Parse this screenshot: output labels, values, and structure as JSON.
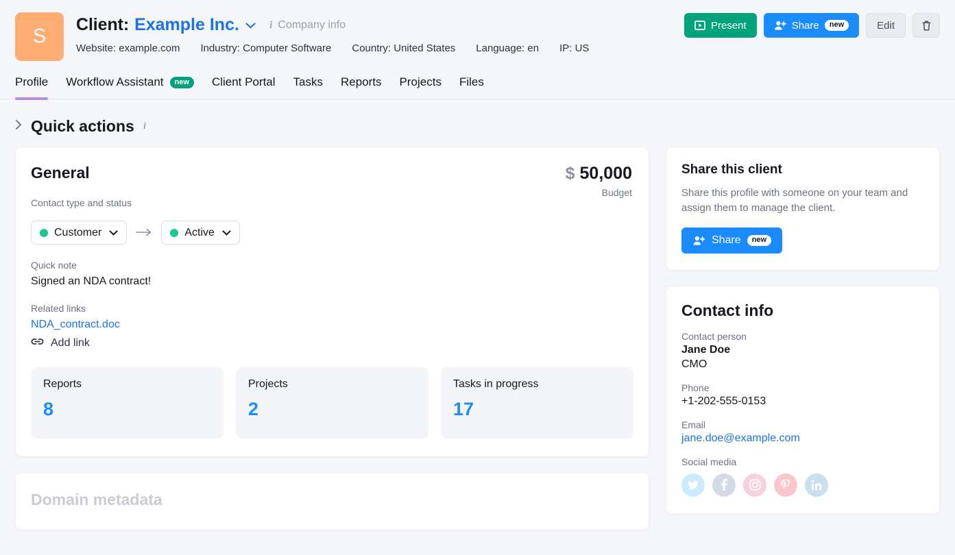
{
  "header": {
    "avatar_initial": "S",
    "avatar_color": "#ffad72",
    "title_prefix": "Client:",
    "client_name": "Example Inc.",
    "chevron": "⌄",
    "info_icon_glyph": "i",
    "company_info_label": "Company info",
    "meta": [
      "Website: example.com",
      "Industry: Computer Software",
      "Country: United States",
      "Language: en",
      "IP: US"
    ],
    "actions": {
      "present_label": "Present",
      "share_label": "Share",
      "share_badge": "new",
      "edit_label": "Edit",
      "present_color": "#00a37c",
      "share_color": "#1a8cff"
    }
  },
  "tabs": {
    "active_index": 0,
    "accent_color": "#b98be8",
    "items": [
      {
        "label": "Profile",
        "badge": ""
      },
      {
        "label": "Workflow Assistant",
        "badge": "new"
      },
      {
        "label": "Client Portal",
        "badge": ""
      },
      {
        "label": "Tasks",
        "badge": ""
      },
      {
        "label": "Reports",
        "badge": ""
      },
      {
        "label": "Projects",
        "badge": ""
      },
      {
        "label": "Files",
        "badge": ""
      }
    ]
  },
  "quick_actions": {
    "chevron": "›",
    "title": "Quick actions",
    "info_icon_glyph": "i"
  },
  "general": {
    "title": "General",
    "budget_currency": "$",
    "budget_amount": "50,000",
    "budget_label": "Budget",
    "contact_type_label": "Contact type and status",
    "contact_type_value": "Customer",
    "status_value": "Active",
    "status_dot_color": "#17c98e",
    "arrow_glyph": "→",
    "chevron": "⌄",
    "quick_note_label": "Quick note",
    "quick_note_value": "Signed an NDA contract!",
    "related_links_label": "Related links",
    "related_link": "NDA_contract.doc",
    "add_link_label": "Add link",
    "stats": [
      {
        "label": "Reports",
        "value": "8"
      },
      {
        "label": "Projects",
        "value": "2"
      },
      {
        "label": "Tasks in progress",
        "value": "17"
      }
    ],
    "stat_value_color": "#1a8cff"
  },
  "domain_metadata": {
    "title": "Domain metadata"
  },
  "share_card": {
    "title": "Share this client",
    "description": "Share this profile with someone on your team and assign them to manage the client.",
    "button_label": "Share",
    "button_badge": "new"
  },
  "contact_info": {
    "title": "Contact info",
    "fields": [
      {
        "label": "Contact person",
        "value": "Jane Doe",
        "value2": "CMO",
        "type": "text"
      },
      {
        "label": "Phone",
        "value": "+1-202-555-0153",
        "type": "text"
      },
      {
        "label": "Email",
        "value": "jane.doe@example.com",
        "type": "link"
      }
    ],
    "social_label": "Social media",
    "social": [
      {
        "name": "twitter-icon",
        "glyph": "✇",
        "color": "#1da1f2"
      },
      {
        "name": "facebook-icon",
        "glyph": "f",
        "color": "#3b5998"
      },
      {
        "name": "instagram-icon",
        "glyph": "▢",
        "color": "#e1306c"
      },
      {
        "name": "pinterest-icon",
        "glyph": "Ⓟ",
        "color": "#e60023"
      },
      {
        "name": "linkedin-icon",
        "glyph": "in",
        "color": "#0077b5"
      }
    ]
  }
}
